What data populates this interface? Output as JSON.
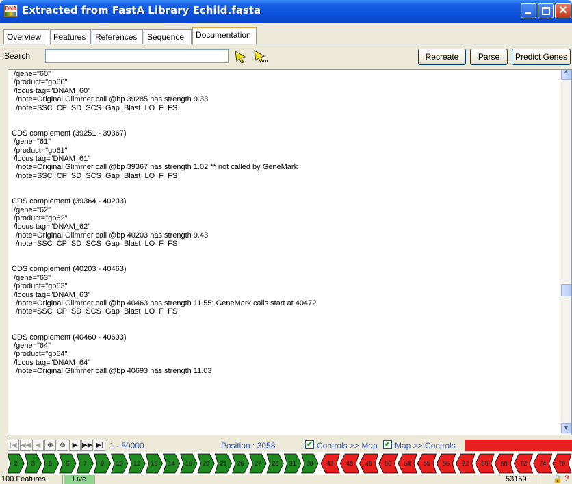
{
  "window": {
    "title": "Extracted from FastA Library Echild.fasta",
    "icon_label": "DNA"
  },
  "tabs": [
    {
      "label": "Overview"
    },
    {
      "label": "Features"
    },
    {
      "label": "References"
    },
    {
      "label": "Sequence"
    },
    {
      "label": "Documentation"
    }
  ],
  "search": {
    "label": "Search",
    "value": ""
  },
  "toolbar": {
    "recreate_label": "Recreate",
    "parse_label": "Parse",
    "predict_label": "Predict Genes"
  },
  "documentation": {
    "text": " /gene=\"60\"\n /product=\"gp60\"\n /locus tag=\"DNAM_60\"\n  /note=Original Glimmer call @bp 39285 has strength 9.33\n  /note=SSC  CP  SD  SCS  Gap  Blast  LO  F  FS\n\n\nCDS complement (39251 - 39367)\n /gene=\"61\"\n /product=\"gp61\"\n /locus tag=\"DNAM_61\"\n  /note=Original Glimmer call @bp 39367 has strength 1.02 ** not called by GeneMark\n  /note=SSC  CP  SD  SCS  Gap  Blast  LO  F  FS\n\n\nCDS complement (39364 - 40203)\n /gene=\"62\"\n /product=\"gp62\"\n /locus tag=\"DNAM_62\"\n  /note=Original Glimmer call @bp 40203 has strength 9.43\n  /note=SSC  CP  SD  SCS  Gap  Blast  LO  F  FS\n\n\nCDS complement (40203 - 40463)\n /gene=\"63\"\n /product=\"gp63\"\n /locus tag=\"DNAM_63\"\n  /note=Original Glimmer call @bp 40463 has strength 11.55; GeneMark calls start at 40472\n  /note=SSC  CP  SD  SCS  Gap  Blast  LO  F  FS\n\n\nCDS complement (40460 - 40693)\n /gene=\"64\"\n /product=\"gp64\"\n /locus tag=\"DNAM_64\"\n  /note=Original Glimmer call @bp 40693 has strength 11.03"
  },
  "nav": {
    "range": "1 - 50000",
    "position": "Position : 3058",
    "controls_to_map": "Controls >> Map",
    "map_to_controls": "Map >> Controls",
    "controls_to_map_checked": true,
    "map_to_controls_checked": true
  },
  "genemap": {
    "forward_color": "#1f8a1f",
    "reverse_color": "#e82020",
    "forward_labels": [
      "2",
      "3",
      "5",
      "6",
      "7",
      "9",
      "10",
      "12",
      "13",
      "14",
      "16",
      "20",
      "21",
      "26",
      "27",
      "28",
      "31",
      "38"
    ],
    "reverse_labels": [
      "43",
      "48",
      "49",
      "50",
      "54",
      "55",
      "56",
      "62",
      "66",
      "68",
      "72",
      "74",
      "79"
    ]
  },
  "status": {
    "features": "100 Features",
    "mode": "Live",
    "length": "53159"
  }
}
